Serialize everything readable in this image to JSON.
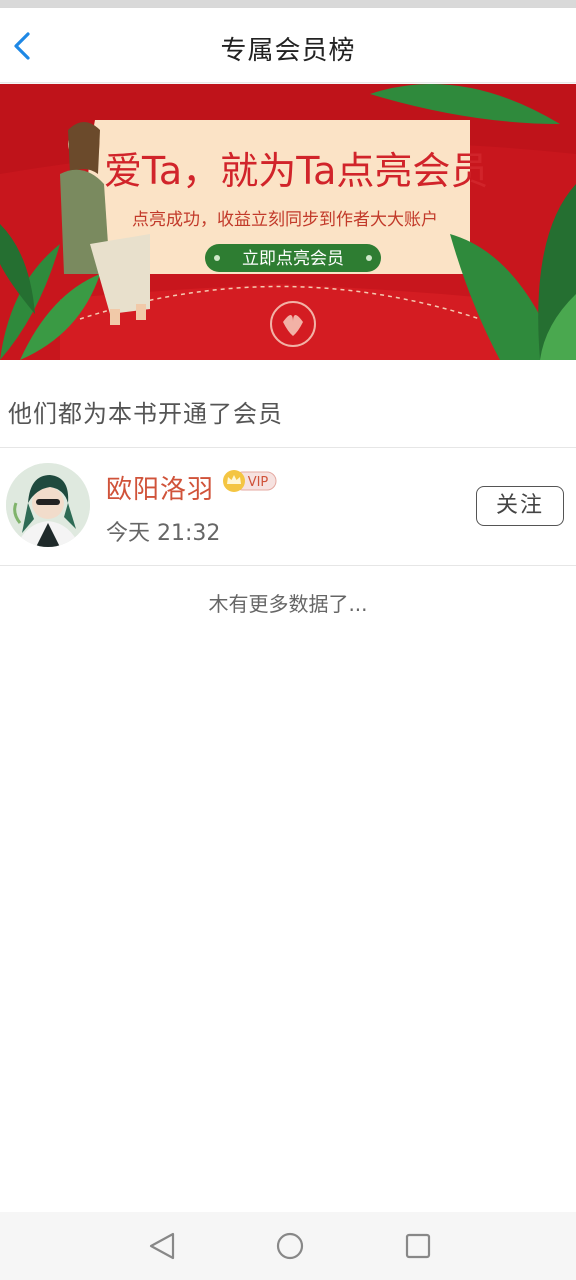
{
  "header": {
    "title": "专属会员榜"
  },
  "banner": {
    "headline": "爱Ta，就为Ta点亮会员",
    "subline": "点亮成功，收益立刻同步到作者大大账户",
    "cta_label": "立即点亮会员",
    "colors": {
      "background": "#c8161d",
      "card": "#fbe3c6",
      "leaf": "#2f8a3c",
      "cta": "#2e7d32"
    }
  },
  "section": {
    "heading": "他们都为本书开通了会员"
  },
  "members": [
    {
      "name": "欧阳洛羽",
      "badge": "VIP",
      "time": "今天 21:32",
      "follow_label": "关注"
    }
  ],
  "list": {
    "end_text": "木有更多数据了..."
  },
  "icons": {
    "back": "chevron-left-icon",
    "vip": "crown-icon",
    "nav_back": "triangle-back-icon",
    "nav_home": "circle-home-icon",
    "nav_recent": "square-recents-icon"
  },
  "theme": {
    "accent": "#1e88e5",
    "name_color": "#d0533a"
  }
}
